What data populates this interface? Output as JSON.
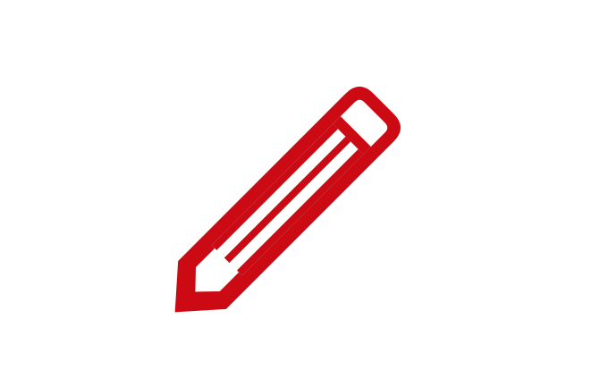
{
  "icon": {
    "name": "pencil-icon",
    "color": "#cc0a14",
    "background": "#ffffff"
  }
}
